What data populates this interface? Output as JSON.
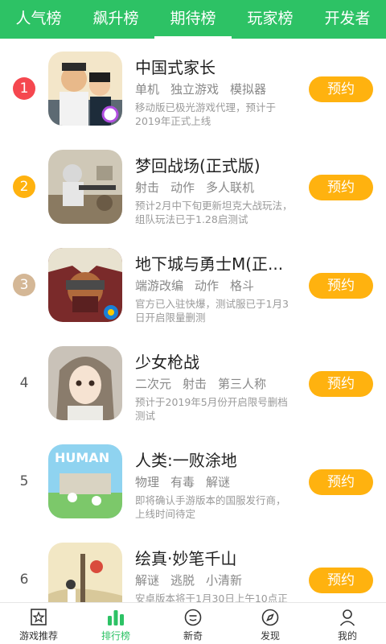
{
  "tabs": [
    {
      "label": "人气榜",
      "active": false
    },
    {
      "label": "飙升榜",
      "active": false
    },
    {
      "label": "期待榜",
      "active": true
    },
    {
      "label": "玩家榜",
      "active": false
    },
    {
      "label": "开发者",
      "active": false
    }
  ],
  "games": [
    {
      "rank": "1",
      "badge_color": "#f5474f",
      "title": "中国式家长",
      "tags": [
        "单机",
        "独立游戏",
        "模拟器"
      ],
      "desc": "移动版已极光游戏代理，预计于2019年正式上线",
      "button": "预约",
      "icon": "family-game-icon"
    },
    {
      "rank": "2",
      "badge_color": "#ffb20f",
      "title": "梦回战场(正式版)",
      "tags": [
        "射击",
        "动作",
        "多人联机"
      ],
      "desc": "预计2月中下旬更新坦克大战玩法，组队玩法已于1.28启测试",
      "button": "预约",
      "icon": "battlefield-game-icon"
    },
    {
      "rank": "3",
      "badge_color": "#d4b796",
      "title": "地下城与勇士M(正...",
      "tags": [
        "端游改编",
        "动作",
        "格斗"
      ],
      "desc": "官方已入驻快爆，测试服已于1月3日开启限量删测",
      "button": "预约",
      "icon": "dnf-game-icon"
    },
    {
      "rank": "4",
      "badge_color": "",
      "title": "少女枪战",
      "tags": [
        "二次元",
        "射击",
        "第三人称"
      ],
      "desc": "预计于2019年5月份开启限号删档测试",
      "button": "预约",
      "icon": "anime-girl-game-icon"
    },
    {
      "rank": "5",
      "badge_color": "",
      "title": "人类:一败涂地",
      "tags": [
        "物理",
        "有毒",
        "解谜"
      ],
      "desc": "即将确认手游版本的国服发行商，上线时间待定",
      "button": "预约",
      "icon": "human-fall-flat-icon"
    },
    {
      "rank": "6",
      "badge_color": "",
      "title": "绘真·妙笔千山",
      "tags": [
        "解谜",
        "逃脱",
        "小清新"
      ],
      "desc": "安卓版本将于1月30日上午10点正",
      "button": "预约",
      "icon": "painting-game-icon"
    }
  ],
  "bottom_nav": [
    {
      "label": "游戏推荐",
      "icon": "star-box-icon",
      "active": false
    },
    {
      "label": "排行榜",
      "icon": "bar-chart-icon",
      "active": true
    },
    {
      "label": "新奇",
      "icon": "smile-bubble-icon",
      "active": false
    },
    {
      "label": "发现",
      "icon": "compass-icon",
      "active": false
    },
    {
      "label": "我的",
      "icon": "person-icon",
      "active": false
    }
  ],
  "colors": {
    "brand": "#2dc265",
    "button": "#ffb20f"
  }
}
